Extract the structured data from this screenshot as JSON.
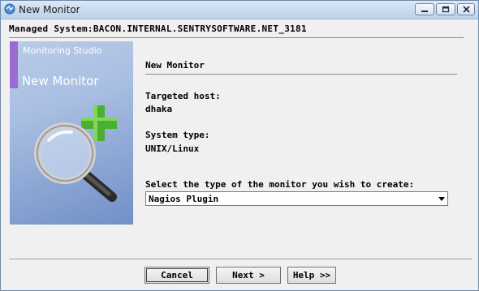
{
  "window": {
    "title": "New Monitor"
  },
  "managed_system": "Managed System:BACON.INTERNAL.SENTRYSOFTWARE.NET_3181",
  "banner": {
    "product": "Monitoring Studio",
    "title": "New Monitor"
  },
  "form": {
    "heading": "New Monitor",
    "targeted_host_label": "Targeted host:",
    "targeted_host_value": "dhaka",
    "system_type_label": "System type:",
    "system_type_value": "UNIX/Linux",
    "monitor_type_label": "Select the type of the monitor you wish to create:",
    "monitor_type_value": "Nagios Plugin"
  },
  "buttons": {
    "cancel": "Cancel",
    "next": "Next >",
    "help": "Help >>"
  },
  "colors": {
    "banner_accent": "#9a6ccf",
    "plus_icon": "#4caf2f",
    "titlebar": "#c9dcef"
  }
}
